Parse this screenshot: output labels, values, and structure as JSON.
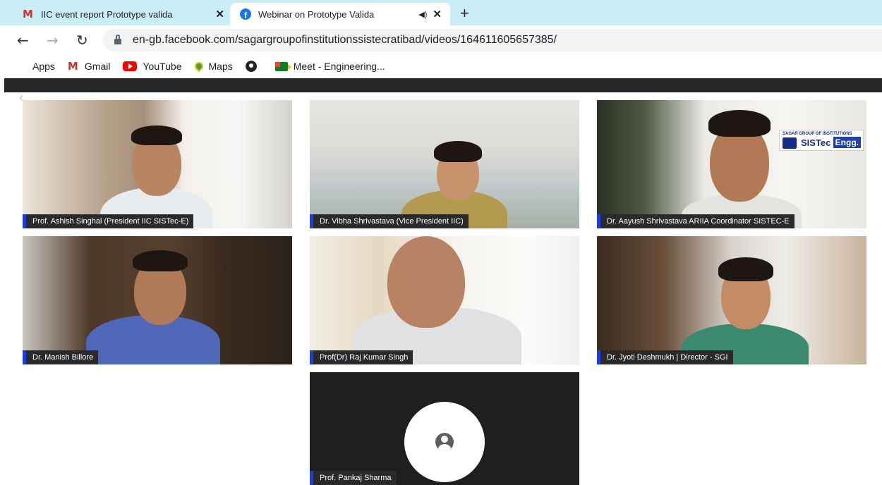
{
  "browser": {
    "tabs": [
      {
        "title": "IIC event report Prototype valida",
        "icon": "gmail-icon",
        "active": false
      },
      {
        "title": "Webinar on Prototype Valida",
        "icon": "facebook-icon",
        "active": true
      }
    ],
    "new_tab_label": "+",
    "close_glyph": "✕",
    "audio_glyph": "◀)",
    "url": "en-gb.facebook.com/sagargroupofinstitutionssistecratibad/videos/164611605657385/",
    "bookmarks": [
      {
        "label": "Apps",
        "icon": "apps-grid-icon"
      },
      {
        "label": "Gmail",
        "icon": "gmail-icon"
      },
      {
        "label": "YouTube",
        "icon": "youtube-icon"
      },
      {
        "label": "Maps",
        "icon": "maps-pin-icon"
      },
      {
        "label": "",
        "icon": "globe-icon"
      },
      {
        "label": "Meet - Engineering...",
        "icon": "meet-icon"
      }
    ]
  },
  "video_grid": {
    "participants": [
      {
        "name": "Prof. Ashish Singhal (President IIC SISTec-E)"
      },
      {
        "name": "Dr. Vibha Shrivastava (Vice President IIC)"
      },
      {
        "name": "Dr. Aayush Shrivastava ARIIA Coordinator SISTEC-E"
      },
      {
        "name": "Dr. Manish Billore"
      },
      {
        "name": "Prof(Dr) Raj Kumar Singh"
      },
      {
        "name": "Dr. Jyoti Deshmukh | Director - SGI"
      },
      {
        "name": "Prof. Pankaj Sharma"
      }
    ],
    "logo": {
      "line1": "SAGAR GROUP OF INSTITUTIONS",
      "main": "SISTec",
      "tag": "Engg."
    }
  },
  "colors": {
    "tab_strip": "#c9eef8",
    "name_accent": "#1a3ce6",
    "page_dark_bar": "#242526"
  }
}
